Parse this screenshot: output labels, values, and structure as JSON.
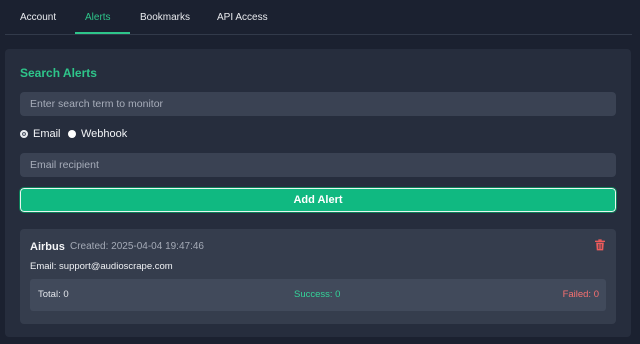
{
  "tabs": [
    {
      "label": "Account",
      "active": false
    },
    {
      "label": "Alerts",
      "active": true
    },
    {
      "label": "Bookmarks",
      "active": false
    },
    {
      "label": "API Access",
      "active": false
    }
  ],
  "form": {
    "title": "Search Alerts",
    "search_placeholder": "Enter search term to monitor",
    "radio_options": [
      {
        "label": "Email",
        "checked": true
      },
      {
        "label": "Webhook",
        "checked": false
      }
    ],
    "recipient_placeholder": "Email recipient",
    "add_button_label": "Add Alert"
  },
  "alerts": [
    {
      "name": "Airbus",
      "created": "Created: 2025-04-04 19:47:46",
      "email": "Email: support@audioscrape.com",
      "total": "Total: 0",
      "success": "Success: 0",
      "failed": "Failed: 0",
      "delete_icon": "trash-icon"
    }
  ],
  "colors": {
    "accent": "#2ec58a",
    "button": "#10b981",
    "success": "#34d399",
    "failed": "#f87171",
    "background": "#1b2130",
    "panel": "#262d3d"
  }
}
